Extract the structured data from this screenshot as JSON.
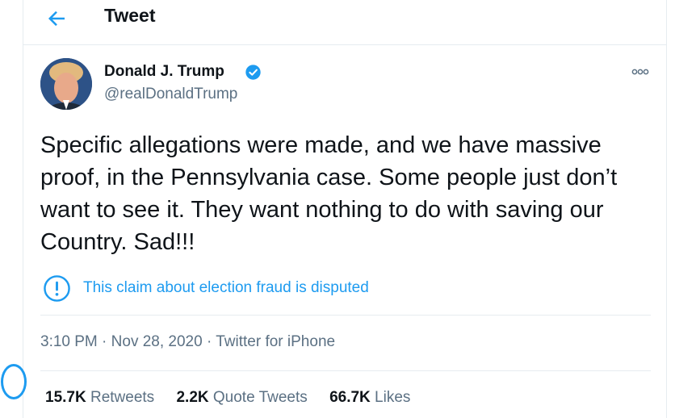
{
  "header": {
    "title": "Tweet"
  },
  "author": {
    "name": "Donald J. Trump",
    "handle": "@realDonaldTrump"
  },
  "tweet": {
    "text": "Specific allegations were made, and we have massive proof, in the Pennsylvania case. Some people just don’t want to see it. They want nothing to do with saving our Country. Sad!!!",
    "notice": "This claim about election fraud is disputed"
  },
  "meta": {
    "time": "3:10 PM",
    "date": "Nov 28, 2020",
    "source": "Twitter for iPhone",
    "separator": "·"
  },
  "stats": [
    {
      "count": "15.7K",
      "label": "Retweets"
    },
    {
      "count": "2.2K",
      "label": "Quote Tweets"
    },
    {
      "count": "66.7K",
      "label": "Likes"
    }
  ],
  "icons": {
    "back": "back-arrow-icon",
    "verified": "verified-badge-icon",
    "more": "more-options-icon",
    "notice": "exclamation-circle-icon"
  },
  "colors": {
    "accent": "#1d9bf0",
    "text": "#0f1419",
    "secondary": "#5b7083",
    "border": "#e6ecf0"
  }
}
